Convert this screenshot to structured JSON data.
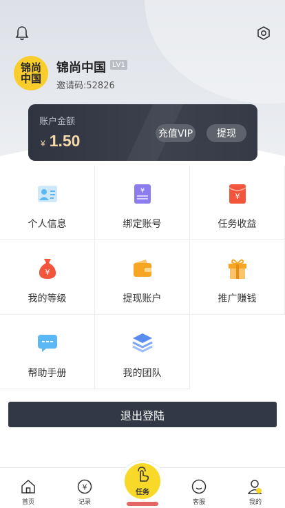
{
  "header": {
    "bell_icon": "bell-icon",
    "settings_icon": "settings-icon"
  },
  "profile": {
    "avatar_line1": "锦尚",
    "avatar_line2": "中国",
    "name": "锦尚中国",
    "level": "LV1",
    "invite_code": "邀请码:52826"
  },
  "balance": {
    "label": "账户金额",
    "currency": "¥",
    "amount": "1.50",
    "recharge_label": "充值VIP",
    "withdraw_label": "提现"
  },
  "menu": [
    {
      "label": "个人信息",
      "icon": "id-card-icon",
      "color": "#5bb8f5"
    },
    {
      "label": "绑定账号",
      "icon": "bank-card-icon",
      "color": "#8b7cf0"
    },
    {
      "label": "任务收益",
      "icon": "red-envelope-icon",
      "color": "#f2553b"
    },
    {
      "label": "我的等级",
      "icon": "money-bag-icon",
      "color": "#f2553b"
    },
    {
      "label": "提现账户",
      "icon": "wallet-icon",
      "color": "#f6a623"
    },
    {
      "label": "推广赚钱",
      "icon": "gift-icon",
      "color": "#f6a623"
    },
    {
      "label": "帮助手册",
      "icon": "chat-icon",
      "color": "#5bb8f5"
    },
    {
      "label": "我的团队",
      "icon": "layers-icon",
      "color": "#5b8df0"
    }
  ],
  "logout_label": "退出登陆",
  "tabbar": {
    "home": "首页",
    "records": "记录",
    "tasks": "任务",
    "service": "客服",
    "mine": "我的"
  }
}
